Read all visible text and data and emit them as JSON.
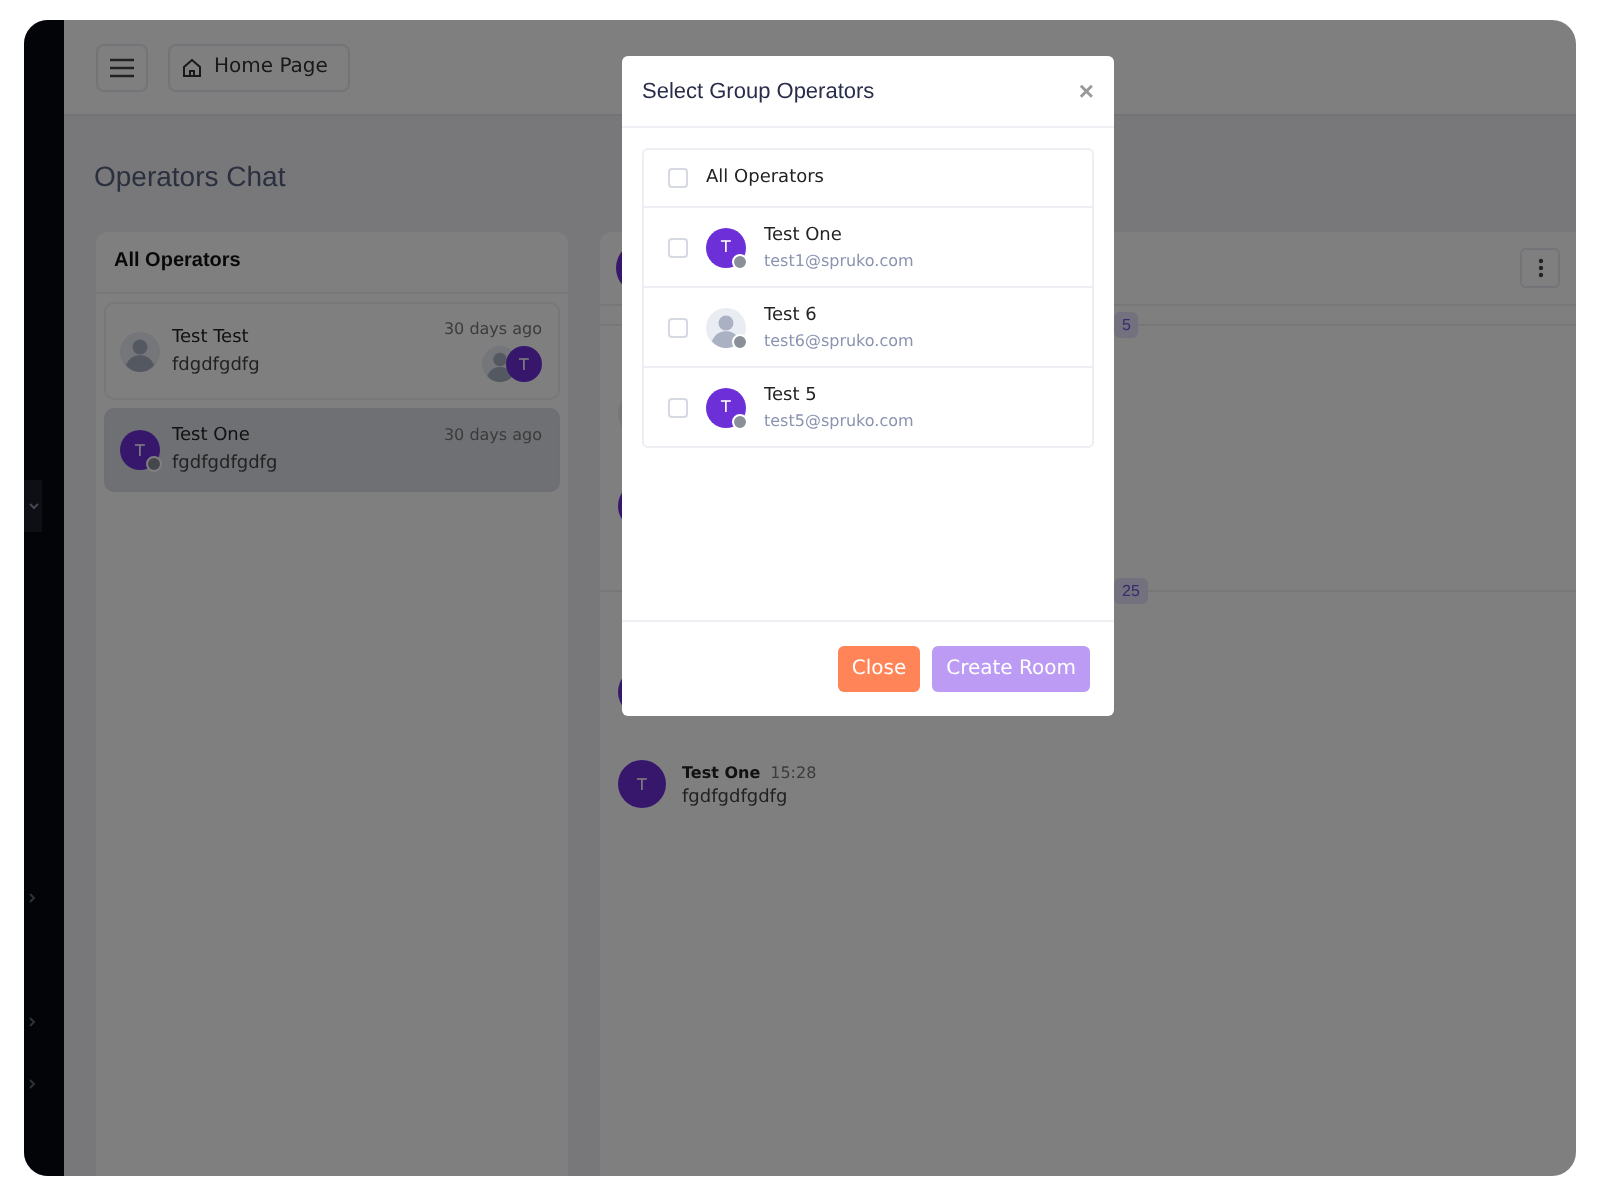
{
  "header": {
    "home_label": "Home Page"
  },
  "page_title": "Operators Chat",
  "operators_panel": {
    "title": "All Operators",
    "items": [
      {
        "name": "Test Test",
        "time": "30 days ago",
        "preview": "fdgdfgdfg",
        "avatar": {
          "kind": "placeholder"
        },
        "selected": false,
        "group_initial": "T"
      },
      {
        "name": "Test One",
        "time": "30 days ago",
        "preview": "fgdfgdfgdfg",
        "avatar": {
          "kind": "initial",
          "initial": "T"
        },
        "selected": true
      }
    ]
  },
  "chat": {
    "entries": [
      {
        "kind": "separator",
        "label": "5"
      },
      {
        "kind": "message",
        "avatar": {
          "kind": "placeholder"
        }
      },
      {
        "kind": "message",
        "avatar": {
          "kind": "initial"
        }
      },
      {
        "kind": "separator",
        "label": "25"
      },
      {
        "kind": "message",
        "avatar": {
          "kind": "initial"
        }
      },
      {
        "kind": "message",
        "avatar": {
          "kind": "initial",
          "initial": "T"
        },
        "name": "Test One",
        "time": "15:28",
        "text": "fgdfgdfgdfg"
      }
    ]
  },
  "modal": {
    "title": "Select Group Operators",
    "close_icon": "×",
    "all": {
      "label": "All Operators",
      "checked": false
    },
    "operators": [
      {
        "name": "Test One",
        "email": "test1@spruko.com",
        "avatar": {
          "kind": "initial",
          "initial": "T"
        },
        "checked": false
      },
      {
        "name": "Test 6",
        "email": "test6@spruko.com",
        "avatar": {
          "kind": "placeholder"
        },
        "checked": false
      },
      {
        "name": "Test 5",
        "email": "test5@spruko.com",
        "avatar": {
          "kind": "initial",
          "initial": "T"
        },
        "checked": false
      }
    ],
    "buttons": [
      {
        "label": "Close",
        "kind": "close",
        "disabled": false
      },
      {
        "label": "Create Room",
        "kind": "create",
        "disabled": true
      }
    ]
  }
}
